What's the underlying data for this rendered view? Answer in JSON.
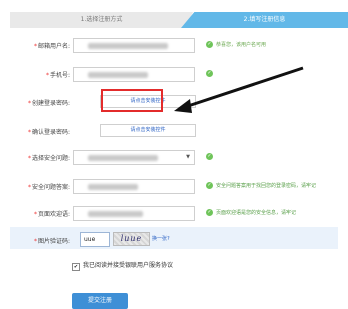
{
  "steps": {
    "step1": "1.选择注册方式",
    "step2": "2.填写注册信息"
  },
  "fields": {
    "username": {
      "label": "邮箱用户名:",
      "hint": "恭喜您，该用户名可用"
    },
    "phone": {
      "label": "手机号:"
    },
    "login_password": {
      "label": "创建登录密码:",
      "control_text": "请点击安装控件"
    },
    "confirm_password": {
      "label": "确认登录密码:",
      "control_text": "请点击安装控件"
    },
    "security_question": {
      "label": "选择安全问题:"
    },
    "security_answer": {
      "label": "安全问题答案:",
      "hint": "安全问题答案用于找回您的登录密码，请牢记"
    },
    "welcome_word": {
      "label": "页面欢迎语:",
      "hint": "页面欢迎语是您的安全信息，请牢记"
    },
    "captcha": {
      "label": "图片验证码:",
      "value": "uue",
      "image_text": "luue",
      "refresh": "换一张?"
    }
  },
  "agreement": {
    "text": "我已阅读并接受 ",
    "link": "",
    "full_text": "我已阅读并接受银联用户服务协议",
    "checked": true
  },
  "submit_label": "提交注册",
  "colors": {
    "accent": "#62b8e8",
    "ok": "#6fc45a",
    "highlight": "#e32b2b",
    "button": "#3e8fd6"
  }
}
